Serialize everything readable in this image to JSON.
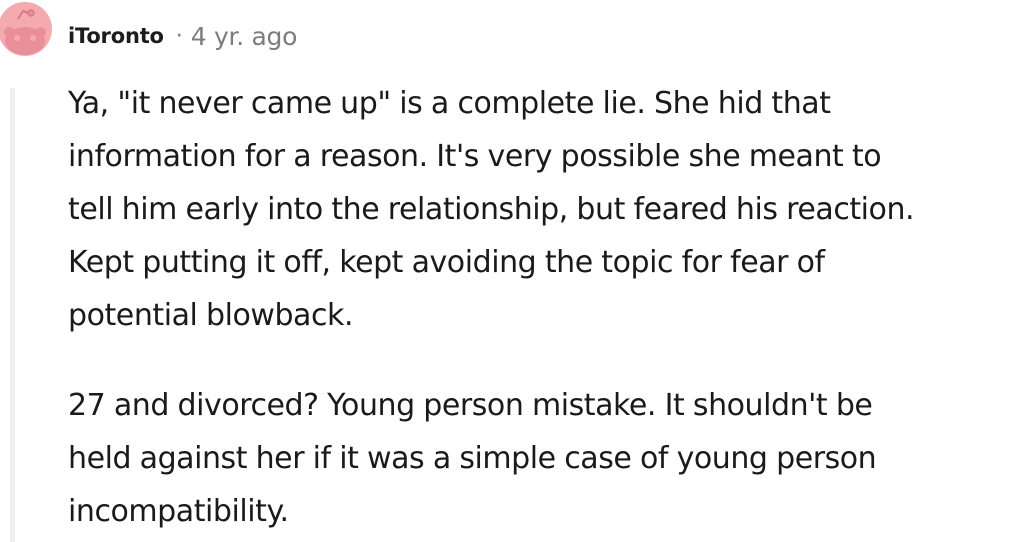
{
  "comment": {
    "author": "iToronto",
    "separator": "·",
    "timestamp": "4 yr. ago",
    "avatar_color": "#f5aab0",
    "avatar_icon": "reddit-snoo-icon",
    "paragraphs": [
      {
        "lines": [
          "Ya, \"it never came up\" is a complete lie. She hid that",
          "information for a reason. It's very possible she meant to",
          "tell him early into the relationship, but feared his reaction.",
          "Kept putting it off, kept avoiding the topic for fear of",
          "potential blowback."
        ]
      },
      {
        "lines": [
          "27 and divorced? Young person mistake. It shouldn't be",
          "held against her if it was a simple case of young person",
          "incompatibility."
        ]
      }
    ]
  }
}
